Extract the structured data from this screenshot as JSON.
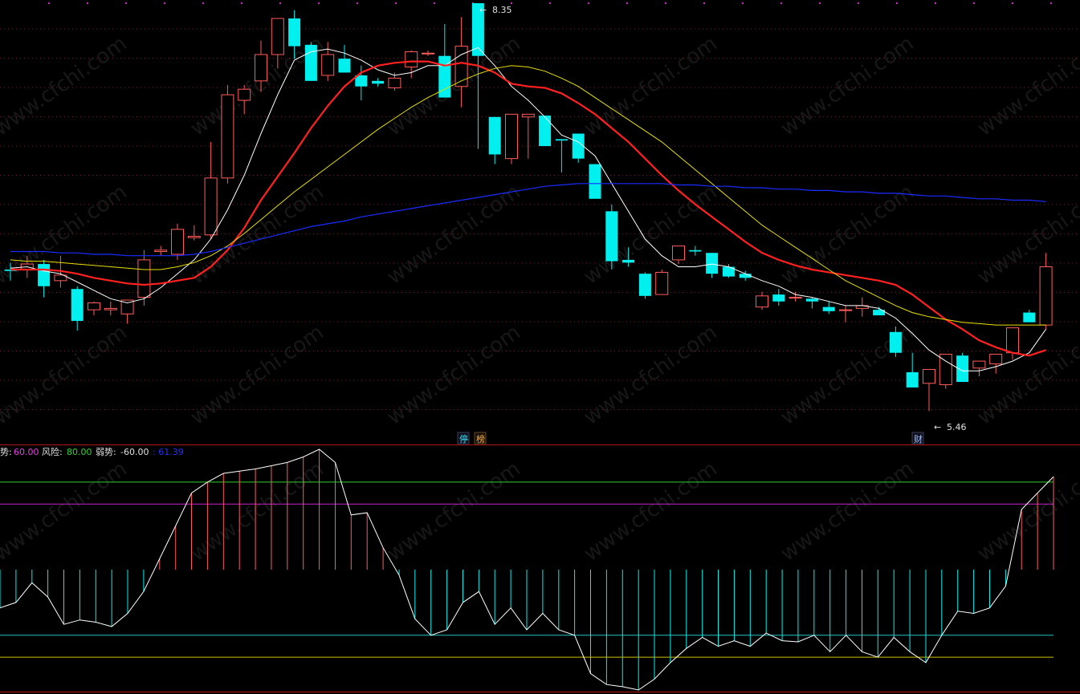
{
  "colors": {
    "background": "#000000",
    "bull": "#ff5a5a",
    "bear": "#00f0f0",
    "ma5": "#ffffff",
    "ma10": "#ff2020",
    "ma20": "#e8e000",
    "ma60": "#1a2cff",
    "grid": "#7a1a1a",
    "separator": "#b01818",
    "level_green": "#30d030",
    "level_magenta": "#d020d0",
    "level_cyan": "#20c8c8",
    "level_yellow": "#d0c000"
  },
  "annotations": {
    "high_label": "8.35",
    "low_label": "5.46",
    "marker_ting": "停",
    "marker_bang": "榜",
    "marker_cai": "财"
  },
  "indicator_header": {
    "strong": {
      "label": "势:",
      "value": "60.00"
    },
    "risk": {
      "label": "风险:",
      "value": "80.00"
    },
    "weak": {
      "label": "弱势:",
      "value": "-60.00"
    },
    "current": {
      "value": ": 61.39"
    }
  },
  "watermark": "www.cfchi.com",
  "chart_data": [
    {
      "type": "candlestick",
      "title": "",
      "y_range": [
        5.3,
        8.4
      ],
      "candles": [
        {
          "o": 6.48,
          "h": 6.53,
          "l": 6.4,
          "c": 6.47
        },
        {
          "o": 6.48,
          "h": 6.58,
          "l": 6.42,
          "c": 6.52
        },
        {
          "o": 6.52,
          "h": 6.55,
          "l": 6.28,
          "c": 6.36
        },
        {
          "o": 6.4,
          "h": 6.58,
          "l": 6.35,
          "c": 6.44
        },
        {
          "o": 6.34,
          "h": 6.36,
          "l": 6.04,
          "c": 6.11
        },
        {
          "o": 6.19,
          "h": 6.25,
          "l": 6.15,
          "c": 6.24
        },
        {
          "o": 6.19,
          "h": 6.25,
          "l": 6.15,
          "c": 6.2
        },
        {
          "o": 6.16,
          "h": 6.24,
          "l": 6.09,
          "c": 6.26
        },
        {
          "o": 6.28,
          "h": 6.62,
          "l": 6.22,
          "c": 6.55
        },
        {
          "o": 6.61,
          "h": 6.65,
          "l": 6.58,
          "c": 6.62
        },
        {
          "o": 6.59,
          "h": 6.81,
          "l": 6.55,
          "c": 6.77
        },
        {
          "o": 6.71,
          "h": 6.8,
          "l": 6.69,
          "c": 6.72
        },
        {
          "o": 6.73,
          "h": 7.4,
          "l": 6.7,
          "c": 7.14
        },
        {
          "o": 7.14,
          "h": 7.81,
          "l": 7.1,
          "c": 7.74
        },
        {
          "o": 7.7,
          "h": 7.81,
          "l": 7.6,
          "c": 7.78
        },
        {
          "o": 7.84,
          "h": 8.13,
          "l": 7.76,
          "c": 8.03
        },
        {
          "o": 8.03,
          "h": 8.25,
          "l": 7.93,
          "c": 8.29
        },
        {
          "o": 8.29,
          "h": 8.35,
          "l": 8.0,
          "c": 8.09
        },
        {
          "o": 8.1,
          "h": 8.12,
          "l": 7.84,
          "c": 7.84
        },
        {
          "o": 7.88,
          "h": 8.12,
          "l": 7.84,
          "c": 8.03
        },
        {
          "o": 8.0,
          "h": 8.1,
          "l": 7.9,
          "c": 7.9
        },
        {
          "o": 7.88,
          "h": 7.95,
          "l": 7.7,
          "c": 7.8
        },
        {
          "o": 7.84,
          "h": 7.86,
          "l": 7.8,
          "c": 7.82
        },
        {
          "o": 7.79,
          "h": 7.9,
          "l": 7.77,
          "c": 7.86
        },
        {
          "o": 7.94,
          "h": 8.06,
          "l": 7.86,
          "c": 8.05
        },
        {
          "o": 8.04,
          "h": 8.06,
          "l": 8.02,
          "c": 8.04
        },
        {
          "o": 8.02,
          "h": 8.25,
          "l": 7.75,
          "c": 7.72
        },
        {
          "o": 7.8,
          "h": 8.3,
          "l": 7.65,
          "c": 8.09
        },
        {
          "o": 8.4,
          "h": 8.4,
          "l": 7.35,
          "c": 8.02
        },
        {
          "o": 7.58,
          "h": 7.58,
          "l": 7.24,
          "c": 7.31
        },
        {
          "o": 7.28,
          "h": 7.6,
          "l": 7.24,
          "c": 7.6
        },
        {
          "o": 7.58,
          "h": 7.58,
          "l": 7.28,
          "c": 7.6
        },
        {
          "o": 7.59,
          "h": 7.59,
          "l": 7.37,
          "c": 7.37
        },
        {
          "o": 7.42,
          "h": 7.42,
          "l": 7.18,
          "c": 7.41
        },
        {
          "o": 7.46,
          "h": 7.46,
          "l": 7.25,
          "c": 7.28
        },
        {
          "o": 7.24,
          "h": 7.24,
          "l": 7.0,
          "c": 6.99
        },
        {
          "o": 6.9,
          "h": 6.95,
          "l": 6.48,
          "c": 6.54
        },
        {
          "o": 6.55,
          "h": 6.64,
          "l": 6.5,
          "c": 6.53
        },
        {
          "o": 6.45,
          "h": 6.46,
          "l": 6.27,
          "c": 6.29
        },
        {
          "o": 6.3,
          "h": 6.48,
          "l": 6.3,
          "c": 6.46
        },
        {
          "o": 6.55,
          "h": 6.65,
          "l": 6.52,
          "c": 6.65
        },
        {
          "o": 6.62,
          "h": 6.65,
          "l": 6.58,
          "c": 6.61
        },
        {
          "o": 6.6,
          "h": 6.6,
          "l": 6.42,
          "c": 6.45
        },
        {
          "o": 6.5,
          "h": 6.52,
          "l": 6.42,
          "c": 6.43
        },
        {
          "o": 6.45,
          "h": 6.47,
          "l": 6.4,
          "c": 6.42
        },
        {
          "o": 6.21,
          "h": 6.32,
          "l": 6.19,
          "c": 6.29
        },
        {
          "o": 6.3,
          "h": 6.34,
          "l": 6.22,
          "c": 6.25
        },
        {
          "o": 6.28,
          "h": 6.32,
          "l": 6.25,
          "c": 6.28
        },
        {
          "o": 6.27,
          "h": 6.28,
          "l": 6.2,
          "c": 6.25
        },
        {
          "o": 6.21,
          "h": 6.25,
          "l": 6.16,
          "c": 6.18
        },
        {
          "o": 6.19,
          "h": 6.22,
          "l": 6.1,
          "c": 6.19
        },
        {
          "o": 6.2,
          "h": 6.28,
          "l": 6.14,
          "c": 6.22
        },
        {
          "o": 6.19,
          "h": 6.21,
          "l": 6.15,
          "c": 6.15
        },
        {
          "o": 6.03,
          "h": 6.07,
          "l": 5.85,
          "c": 5.88
        },
        {
          "o": 5.74,
          "h": 5.88,
          "l": 5.66,
          "c": 5.63
        },
        {
          "o": 5.66,
          "h": 5.74,
          "l": 5.46,
          "c": 5.76
        },
        {
          "o": 5.65,
          "h": 5.87,
          "l": 5.62,
          "c": 5.87
        },
        {
          "o": 5.86,
          "h": 5.88,
          "l": 5.68,
          "c": 5.67
        },
        {
          "o": 5.77,
          "h": 5.78,
          "l": 5.71,
          "c": 5.82
        },
        {
          "o": 5.8,
          "h": 5.85,
          "l": 5.73,
          "c": 5.87
        },
        {
          "o": 5.88,
          "h": 6.0,
          "l": 5.83,
          "c": 6.06
        },
        {
          "o": 6.17,
          "h": 6.19,
          "l": 6.1,
          "c": 6.1
        },
        {
          "o": 6.08,
          "h": 6.6,
          "l": 6.05,
          "c": 6.5
        }
      ],
      "series": [
        {
          "name": "",
          "key": "ma5",
          "values": [
            6.49,
            6.5,
            6.47,
            6.45,
            6.39,
            6.33,
            6.27,
            6.24,
            6.27,
            6.35,
            6.45,
            6.55,
            6.7,
            6.91,
            7.16,
            7.46,
            7.74,
            7.99,
            8.05,
            8.07,
            8.04,
            7.99,
            7.92,
            7.88,
            7.9,
            7.95,
            7.95,
            8.03,
            8.08,
            7.95,
            7.8,
            7.7,
            7.58,
            7.45,
            7.4,
            7.3,
            7.1,
            6.9,
            6.7,
            6.58,
            6.5,
            6.5,
            6.52,
            6.5,
            6.45,
            6.4,
            6.36,
            6.3,
            6.28,
            6.25,
            6.22,
            6.22,
            6.2,
            6.13,
            6.02,
            5.9,
            5.82,
            5.75,
            5.75,
            5.78,
            5.82,
            5.88,
            6.05
          ]
        },
        {
          "name": "",
          "key": "ma10",
          "values": [
            6.48,
            6.48,
            6.48,
            6.47,
            6.45,
            6.42,
            6.4,
            6.38,
            6.37,
            6.38,
            6.4,
            6.42,
            6.5,
            6.62,
            6.78,
            6.98,
            7.15,
            7.32,
            7.5,
            7.66,
            7.8,
            7.9,
            7.95,
            7.97,
            7.98,
            7.98,
            7.95,
            7.97,
            7.95,
            7.9,
            7.82,
            7.8,
            7.79,
            7.75,
            7.68,
            7.6,
            7.5,
            7.4,
            7.28,
            7.16,
            7.05,
            6.95,
            6.86,
            6.77,
            6.68,
            6.6,
            6.55,
            6.51,
            6.48,
            6.46,
            6.44,
            6.42,
            6.4,
            6.37,
            6.3,
            6.21,
            6.12,
            6.05,
            5.97,
            5.92,
            5.88,
            5.86,
            5.9
          ]
        },
        {
          "name": "",
          "key": "ma20",
          "values": [
            6.55,
            6.54,
            6.54,
            6.53,
            6.52,
            6.51,
            6.5,
            6.49,
            6.48,
            6.48,
            6.5,
            6.53,
            6.58,
            6.65,
            6.74,
            6.84,
            6.94,
            7.04,
            7.13,
            7.22,
            7.31,
            7.4,
            7.49,
            7.57,
            7.65,
            7.72,
            7.78,
            7.84,
            7.89,
            7.93,
            7.95,
            7.94,
            7.91,
            7.86,
            7.8,
            7.72,
            7.64,
            7.56,
            7.48,
            7.4,
            7.3,
            7.2,
            7.1,
            7.0,
            6.9,
            6.8,
            6.72,
            6.64,
            6.56,
            6.48,
            6.4,
            6.34,
            6.28,
            6.22,
            6.17,
            6.14,
            6.12,
            6.1,
            6.09,
            6.08,
            6.08,
            6.08,
            6.08
          ]
        },
        {
          "name": "",
          "key": "ma60",
          "values": [
            6.61,
            6.61,
            6.61,
            6.6,
            6.6,
            6.59,
            6.59,
            6.58,
            6.58,
            6.58,
            6.58,
            6.59,
            6.61,
            6.64,
            6.67,
            6.7,
            6.73,
            6.76,
            6.79,
            6.81,
            6.83,
            6.86,
            6.88,
            6.9,
            6.92,
            6.94,
            6.96,
            6.98,
            7.0,
            7.02,
            7.04,
            7.06,
            7.08,
            7.09,
            7.1,
            7.1,
            7.1,
            7.1,
            7.1,
            7.1,
            7.09,
            7.09,
            7.08,
            7.08,
            7.07,
            7.07,
            7.06,
            7.06,
            7.05,
            7.05,
            7.04,
            7.04,
            7.03,
            7.03,
            7.02,
            7.01,
            7.01,
            7.0,
            6.99,
            6.99,
            6.98,
            6.98,
            6.97
          ]
        }
      ]
    },
    {
      "type": "bar",
      "title": "",
      "y_range": [
        -110,
        110
      ],
      "levels": [
        {
          "key": "level_green",
          "value": 80
        },
        {
          "key": "level_magenta",
          "value": 60
        },
        {
          "key": "level_cyan",
          "value": -60
        },
        {
          "key": "level_yellow",
          "value": -80
        }
      ],
      "values": [
        -35,
        -30,
        -12,
        -25,
        -50,
        -46,
        -48,
        -52,
        -40,
        -20,
        10,
        40,
        70,
        80,
        88,
        90,
        92,
        95,
        98,
        103,
        110,
        98,
        50,
        52,
        20,
        -5,
        -45,
        -60,
        -55,
        -30,
        -20,
        -50,
        -35,
        -55,
        -40,
        -55,
        -60,
        -95,
        -105,
        -107,
        -110,
        -100,
        -85,
        -72,
        -62,
        -70,
        -65,
        -70,
        -58,
        -65,
        -66,
        -60,
        -75,
        -60,
        -75,
        -80,
        -62,
        -75,
        -85,
        -60,
        -38,
        -40,
        -35,
        -15,
        55,
        70,
        85
      ]
    }
  ]
}
